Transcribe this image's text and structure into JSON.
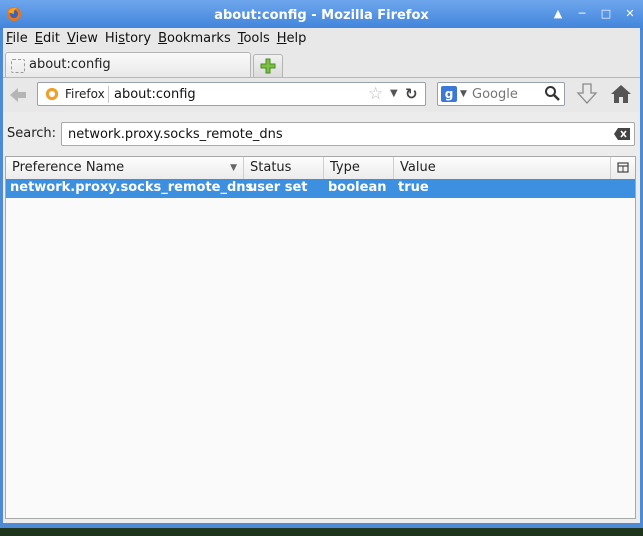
{
  "window": {
    "title": "about:config - Mozilla Firefox"
  },
  "menu": [
    {
      "accel": "F",
      "rest": "ile"
    },
    {
      "accel": "E",
      "rest": "dit"
    },
    {
      "accel": "V",
      "rest": "iew"
    },
    {
      "pre": "Hi",
      "accel": "s",
      "rest": "tory"
    },
    {
      "accel": "B",
      "rest": "ookmarks"
    },
    {
      "accel": "T",
      "rest": "ools"
    },
    {
      "accel": "H",
      "rest": "elp"
    }
  ],
  "tab": {
    "label": "about:config"
  },
  "navbar": {
    "identity": "Firefox",
    "url": "about:config",
    "search_placeholder": "Google"
  },
  "config": {
    "search_label": "Search:",
    "search_value": "network.proxy.socks_remote_dns",
    "columns": [
      "Preference Name",
      "Status",
      "Type",
      "Value"
    ],
    "rows": [
      {
        "name": "network.proxy.socks_remote_dns",
        "status": "user set",
        "type": "boolean",
        "value": "true"
      }
    ]
  },
  "colors": {
    "titlebar": "#3f83db",
    "selection": "#3d8fe0"
  },
  "icons": [
    "firefox-icon",
    "back-icon",
    "star-icon",
    "reload-icon",
    "google-icon",
    "magnifier-icon",
    "download-icon",
    "home-icon",
    "clear-icon",
    "column-picker-icon"
  ]
}
